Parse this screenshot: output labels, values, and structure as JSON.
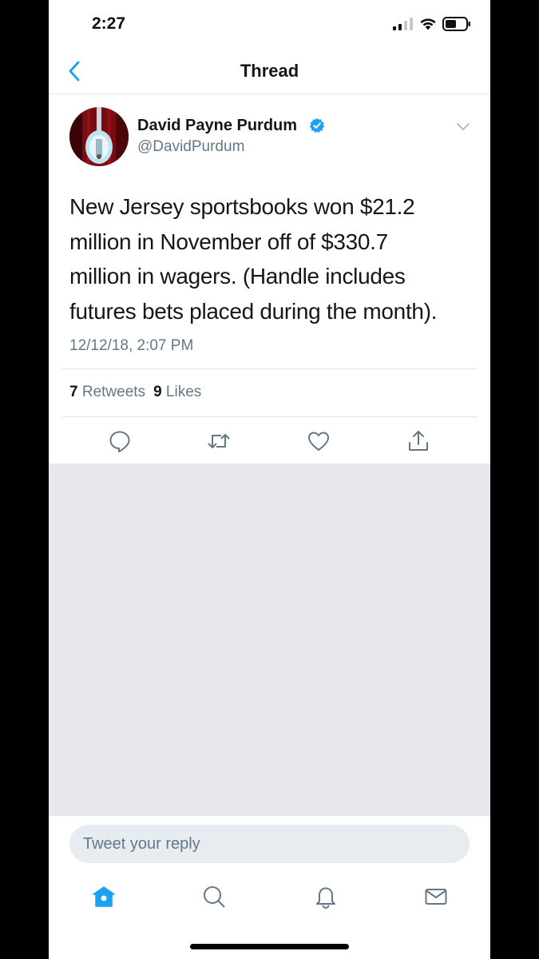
{
  "status_bar": {
    "time": "2:27",
    "icons": [
      "signal-icon",
      "wifi-icon",
      "battery-icon"
    ]
  },
  "nav": {
    "title": "Thread",
    "back_icon": "chevron-left-icon"
  },
  "tweet": {
    "author_name": "David Payne Purdum",
    "author_handle": "@DavidPurdum",
    "verified": true,
    "text_lines": [
      "New Jersey sportsbooks won $21.2",
      "million in November off of $330.7",
      "million in wagers. (Handle includes",
      "futures bets placed during the month)."
    ],
    "timestamp": "12/12/18, 2:07 PM",
    "retweet_count": "7",
    "retweet_label": "Retweets",
    "like_count": "9",
    "like_label": "Likes",
    "actions": [
      "reply-icon",
      "retweet-icon",
      "like-icon",
      "share-icon"
    ]
  },
  "reply": {
    "placeholder": "Tweet your reply"
  },
  "tab_bar": {
    "tabs": [
      "home-icon",
      "search-icon",
      "notifications-icon",
      "messages-icon"
    ],
    "active": "home-icon"
  },
  "colors": {
    "accent": "#1da1f2",
    "text": "#14171a",
    "secondary_text": "#657786",
    "divider": "#e1e8ed",
    "background_gray": "#e6e8ed"
  }
}
